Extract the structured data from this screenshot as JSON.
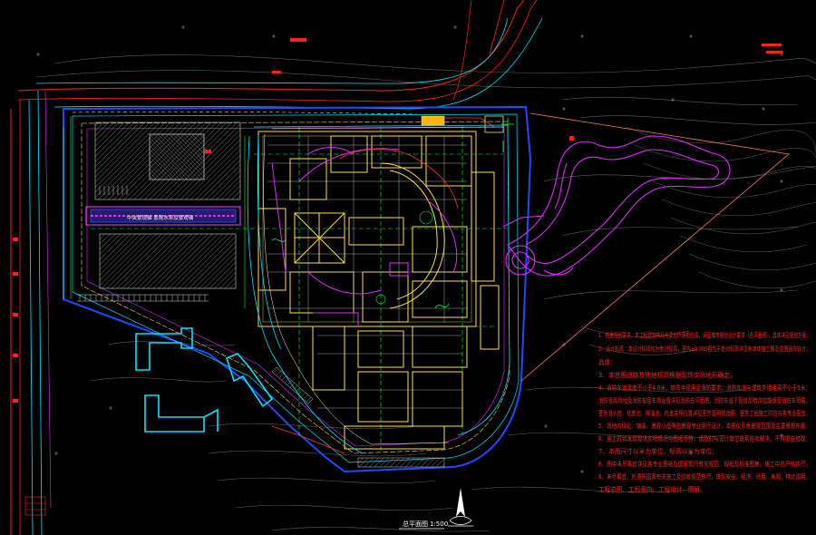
{
  "drawing": {
    "background": "#000000",
    "colors": {
      "road_red": "#ff2020",
      "road_cyan": "#00e5ff",
      "boundary_blue": "#1e4bff",
      "building_yellow": "#ffe04a",
      "landscape_magenta": "#e02cff",
      "contour_gray": "#7a7a7a",
      "green_grid": "#00ff44",
      "annotation_red": "#ff2a2a",
      "white": "#ffffff"
    },
    "plan_title": "总平面图",
    "plan_scale": "1:500",
    "site_label": "中央景观轴 景观水系及景观轴",
    "notes": [
      "1、根据规划要求，本工程建筑布局与周边环境相协调，满足城市规划设计要求（总平面图），具体详见规划方案。",
      "2、设计标高：本设计标高均为绝对标高，室内±0.000相当于绝对标高详见各单体施工图及总图竖向设计。",
      "具体：",
      "3、本总图道路及场地标高根据现场实测地形确定。",
      "4、消防车道宽度不小于4.0米，转弯半径满足消防要求，消防车道与建筑外墙距离不小于5米；",
      "消防登高场地及消防车回车场设置详见消防总平面图，消防车道下管道及暗沟应能承受消防车荷载；",
      "室外消火栓、化粪池、隔油池、检查井等位置详见室外管网综合图，室外工程施工时应与各专业配合；",
      "5、场地内绿化、铺装、景观小品等由景观专业另行设计，本图仅示意景观范围及主要景观布置；",
      "6、施工时如发现现场实际情况与图纸不符，请及时与设计单位联系协商解决，不得擅自修改；",
      "7、本图尺寸以米为单位，标高以米为单位；",
      "8、图中未尽事宜详见各专业图纸及国家现行有关规范、规程及标准图集，施工中应严格执行；",
      "9、未尽事宜，应遵照国家有关施工及验收规范执行，做到安全、经济、适用、美观，特此说明。",
      "工程总图、工程竖向、工程设计、图纸。"
    ]
  }
}
